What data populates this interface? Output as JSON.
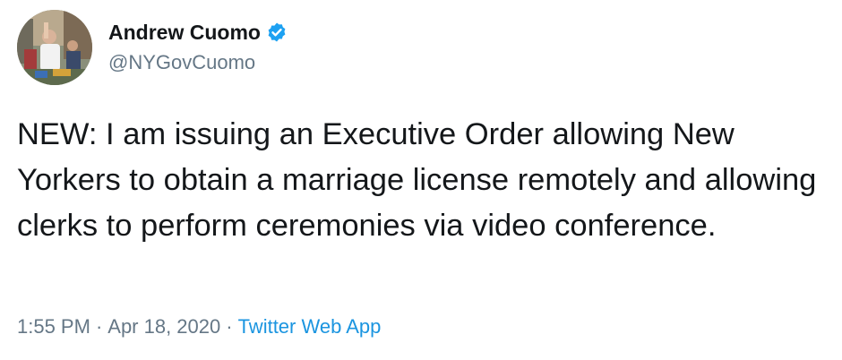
{
  "author": {
    "display_name": "Andrew Cuomo",
    "handle": "@NYGovCuomo",
    "verified": true,
    "avatar_icon": "profile-photo"
  },
  "tweet": {
    "text": "NEW: I am issuing an Executive Order allowing New Yorkers to obtain a marriage license remotely and allowing clerks to perform ceremonies via video conference."
  },
  "meta": {
    "time": "1:55 PM",
    "separator": "·",
    "date": "Apr 18, 2020",
    "source": "Twitter Web App"
  },
  "colors": {
    "text": "#14171a",
    "secondary": "#657786",
    "link": "#1b95e0",
    "verified_badge": "#1da1f2"
  }
}
